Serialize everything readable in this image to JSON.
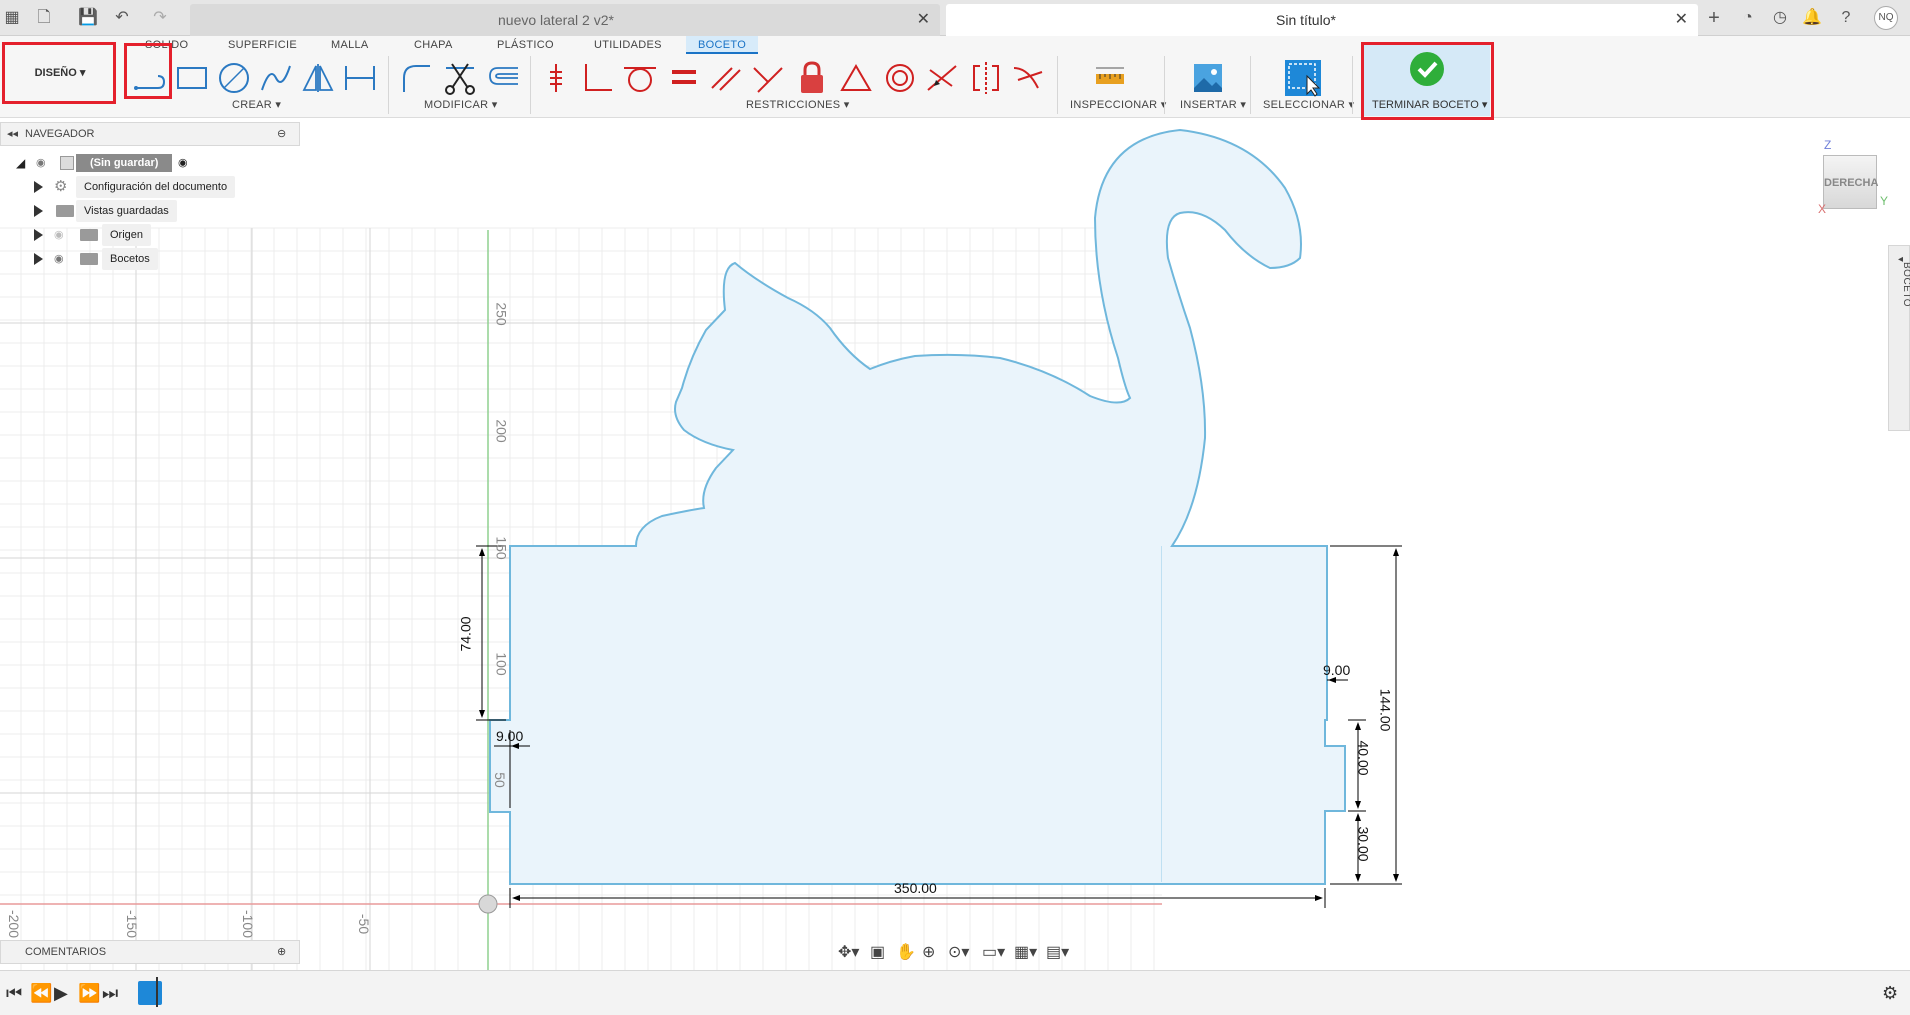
{
  "titlebar": {
    "tabs": [
      {
        "label": "nuevo lateral 2 v2*",
        "active": false
      },
      {
        "label": "Sin título*",
        "active": true
      }
    ],
    "user_initials": "NQ"
  },
  "workspace": {
    "label": "DISEÑO"
  },
  "ribbon": {
    "tabs": [
      "SOLIDO",
      "SUPERFICIE",
      "MALLA",
      "CHAPA",
      "PLÁSTICO",
      "UTILIDADES",
      "BOCETO"
    ],
    "active_tab": "BOCETO",
    "groups": {
      "create": "CREAR",
      "modify": "MODIFICAR",
      "constraints": "RESTRICCIONES",
      "inspect": "INSPECCIONAR",
      "insert": "INSERTAR",
      "select": "SELECCIONAR",
      "finish": "TERMINAR BOCETO"
    }
  },
  "browser": {
    "title": "NAVEGADOR",
    "root": "(Sin guardar)",
    "items": [
      {
        "label": "Configuración del documento",
        "icon": "gear-icon"
      },
      {
        "label": "Vistas guardadas",
        "icon": "folder-icon"
      },
      {
        "label": "Origen",
        "icon": "folder-icon"
      },
      {
        "label": "Bocetos",
        "icon": "folder-icon"
      }
    ]
  },
  "comments": {
    "title": "COMENTARIOS"
  },
  "viewcube": {
    "face": "DERECHA",
    "axis_z": "Z",
    "axis_y": "Y",
    "axis_x": "X"
  },
  "palette": {
    "label": "PALETA DE BOCETO"
  },
  "axis_ticks": {
    "vertical": [
      "250",
      "200",
      "150",
      "100",
      "50"
    ],
    "horizontal": [
      "-200",
      "-150",
      "-100",
      "-50"
    ]
  },
  "dimensions": {
    "left_height": "74.00",
    "left_notch_depth": "9.00",
    "right_notch_depth": "9.00",
    "right_total": "144.00",
    "right_notch_height": "40.00",
    "right_bottom": "30.00",
    "bottom_width": "350.00"
  },
  "colors": {
    "accent": "#1a73c6",
    "highlight": "#e4202c",
    "sketch_fill": "#eaf4fb",
    "sketch_line": "#6fb7dc",
    "finish_green": "#2fae3a"
  }
}
